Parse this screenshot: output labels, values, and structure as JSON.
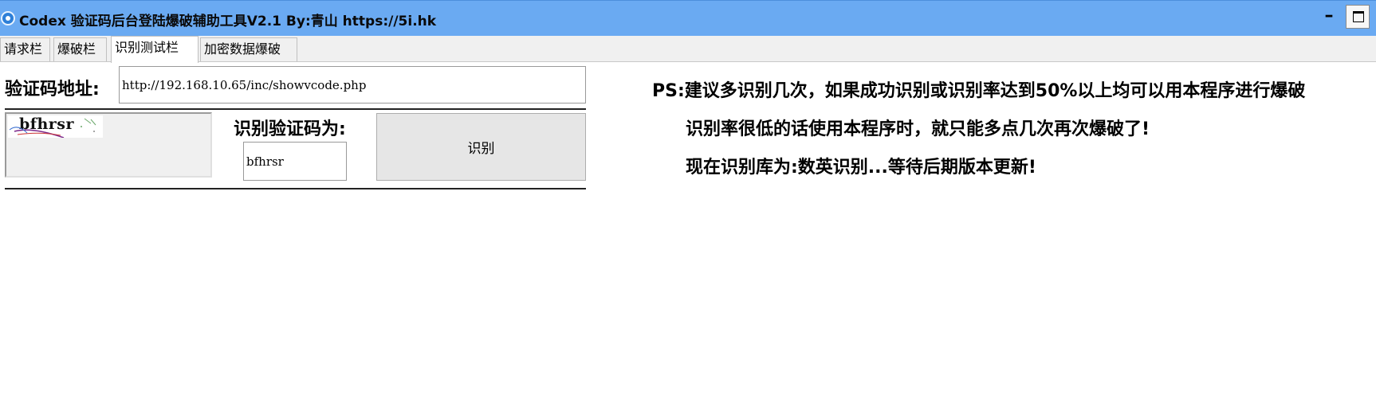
{
  "window": {
    "title": "Codex 验证码后台登陆爆破辅助工具V2.1  By:青山 https://5i.hk",
    "min_symbol": "–",
    "icon": "app-icon",
    "max_icon": "maximize-icon"
  },
  "tabs": [
    {
      "label": "请求栏",
      "active": false
    },
    {
      "label": "爆破栏",
      "active": false
    },
    {
      "label": "识别测试栏",
      "active": true
    },
    {
      "label": "加密数据爆破",
      "active": false
    }
  ],
  "form": {
    "url_label": "验证码地址:",
    "url_value": "http://192.168.10.65/inc/showvcode.php",
    "captcha_text": "bfhrsr",
    "result_label": "识别验证码为:",
    "result_value": "bfhrsr",
    "recognize_button": "识别"
  },
  "notes": [
    "PS:建议多识别几次，如果成功识别或识别率达到50%以上均可以用本程序进行爆破",
    "识别率很低的话使用本程序时，就只能多点几次再次爆破了!",
    "现在识别库为:数英识别...等待后期版本更新!"
  ],
  "colors": {
    "titlebar": "#6aaaf2",
    "background": "#ffffff",
    "tabstrip": "#f0f0f0"
  }
}
